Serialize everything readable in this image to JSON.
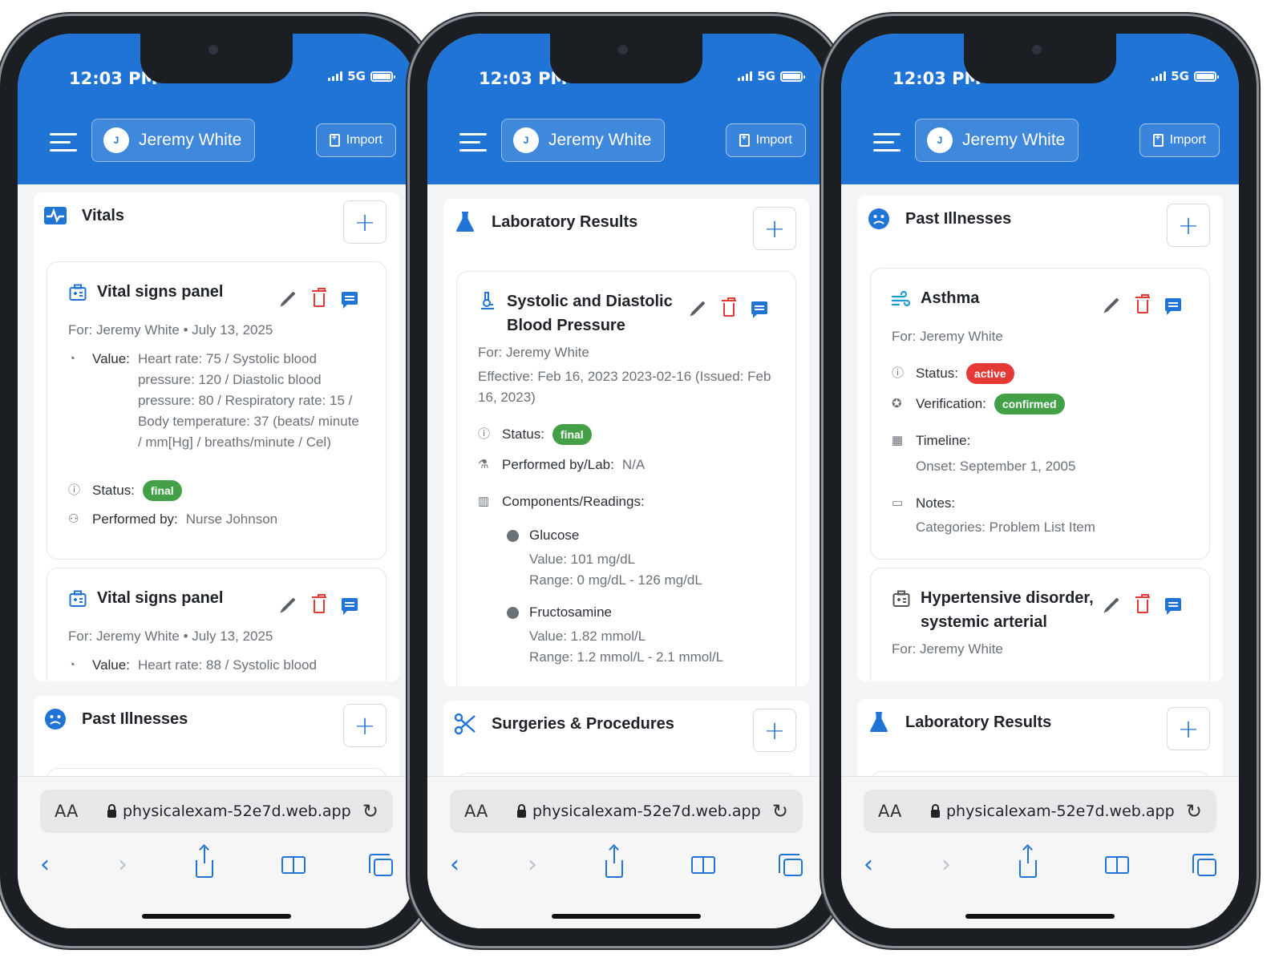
{
  "status_bar": {
    "time": "12:03 PM",
    "network": "5G"
  },
  "header": {
    "patient_initial": "J",
    "patient_name": "Jeremy White",
    "import_label": "Import"
  },
  "browser": {
    "text_size": "AA",
    "url": "physicalexam-52e7d.web.app"
  },
  "phone1": {
    "vitals_title": "Vitals",
    "card1": {
      "title": "Vital signs panel",
      "meta": "For: Jeremy White • July 13, 2025",
      "value_label": "Value:",
      "value": "Heart rate: 75 / Systolic blood pressure: 120 / Diastolic blood pressure: 80 / Respiratory rate: 15 / Body temperature: 37 (beats/ minute / mm[Hg] / breaths/minute / Cel)",
      "status_label": "Status:",
      "status": "final",
      "performed_label": "Performed by:",
      "performed": "Nurse Johnson"
    },
    "card2": {
      "title": "Vital signs panel",
      "meta": "For: Jeremy White • July 13, 2025",
      "value_label": "Value:",
      "value": "Heart rate: 88 / Systolic blood"
    },
    "past_title": "Past Illnesses"
  },
  "phone2": {
    "lab_title": "Laboratory Results",
    "card": {
      "title_line1": "Systolic and Diastolic",
      "title_line2": "Blood Pressure",
      "for": "For: Jeremy White",
      "effective": "Effective: Feb 16, 2023 2023-02-16 (Issued: Feb 16, 2023)",
      "status_label": "Status:",
      "status": "final",
      "performed_label": "Performed by/Lab:",
      "performed": "N/A",
      "components_label": "Components/Readings:",
      "components": [
        {
          "name": "Glucose",
          "value": "Value: 101 mg/dL",
          "range": "Range: 0 mg/dL - 126 mg/dL"
        },
        {
          "name": "Fructosamine",
          "value": "Value: 1.82 mmol/L",
          "range": "Range: 1.2 mmol/L - 2.1 mmol/L"
        }
      ]
    },
    "surgeries_title": "Surgeries & Procedures"
  },
  "phone3": {
    "past_title": "Past Illnesses",
    "card1": {
      "title": "Asthma",
      "for": "For: Jeremy White",
      "status_label": "Status:",
      "status": "active",
      "verification_label": "Verification:",
      "verification": "confirmed",
      "timeline_label": "Timeline:",
      "onset": "Onset: September 1, 2005",
      "notes_label": "Notes:",
      "categories": "Categories: Problem List Item"
    },
    "card2": {
      "title_line1": "Hypertensive disorder,",
      "title_line2": "systemic arterial",
      "for": "For: Jeremy White"
    },
    "lab_title": "Laboratory Results"
  },
  "colors": {
    "brand": "#1f74d6",
    "final_badge": "#43a047",
    "active_badge": "#e53935",
    "delete": "#e53935"
  },
  "icons": [
    "menu-icon",
    "import-icon",
    "vitals-icon",
    "plus-icon",
    "panel-icon",
    "edit-icon",
    "trash-icon",
    "comment-icon",
    "gauge-icon",
    "info-icon",
    "person-icon",
    "flask-icon",
    "microscope-icon",
    "chart-icon",
    "sad-face-icon",
    "wind-icon",
    "badge-check-icon",
    "calendar-icon",
    "folder-icon",
    "scissors-icon",
    "lock-icon",
    "reload-icon",
    "back-icon",
    "forward-icon",
    "share-icon",
    "bookmarks-icon",
    "tabs-icon"
  ]
}
